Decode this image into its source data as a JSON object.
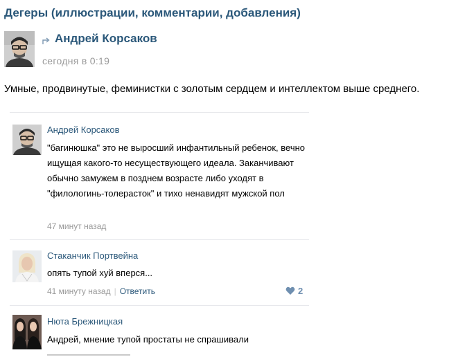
{
  "page": {
    "title": "Дегеры (иллюстрации, комментарии, добавления)"
  },
  "post": {
    "author": "Андрей Корсаков",
    "time": "сегодня в 0:19",
    "text": "Умные, продвинутые, феминистки с золотым сердцем и интеллектом выше среднего.",
    "repost_icon": "repost-arrow-icon"
  },
  "comments": [
    {
      "author": "Андрей Корсаков",
      "text": "\"багинюшка\" это не выросший инфантильный ребенок, вечно ищущая какого-то несуществующего идеала. Заканчивают обычно замужем в позднем возрасте либо уходят в \"филологинь-толерасток\" и тихо ненавидят мужской пол",
      "time": "47 минут назад"
    },
    {
      "author": "Стаканчик Портвейна",
      "text": "опять тупой хуй вперся...",
      "time": "41 минуту назад",
      "reply_label": "Ответить",
      "likes": "2",
      "like_icon": "heart-icon"
    },
    {
      "author": "Нюта Брежницкая",
      "text": "Андрей, мнение тупой простаты не спрашивали"
    }
  ],
  "colors": {
    "link": "#2b587a",
    "muted": "#999999",
    "like": "#6f8fb0"
  }
}
